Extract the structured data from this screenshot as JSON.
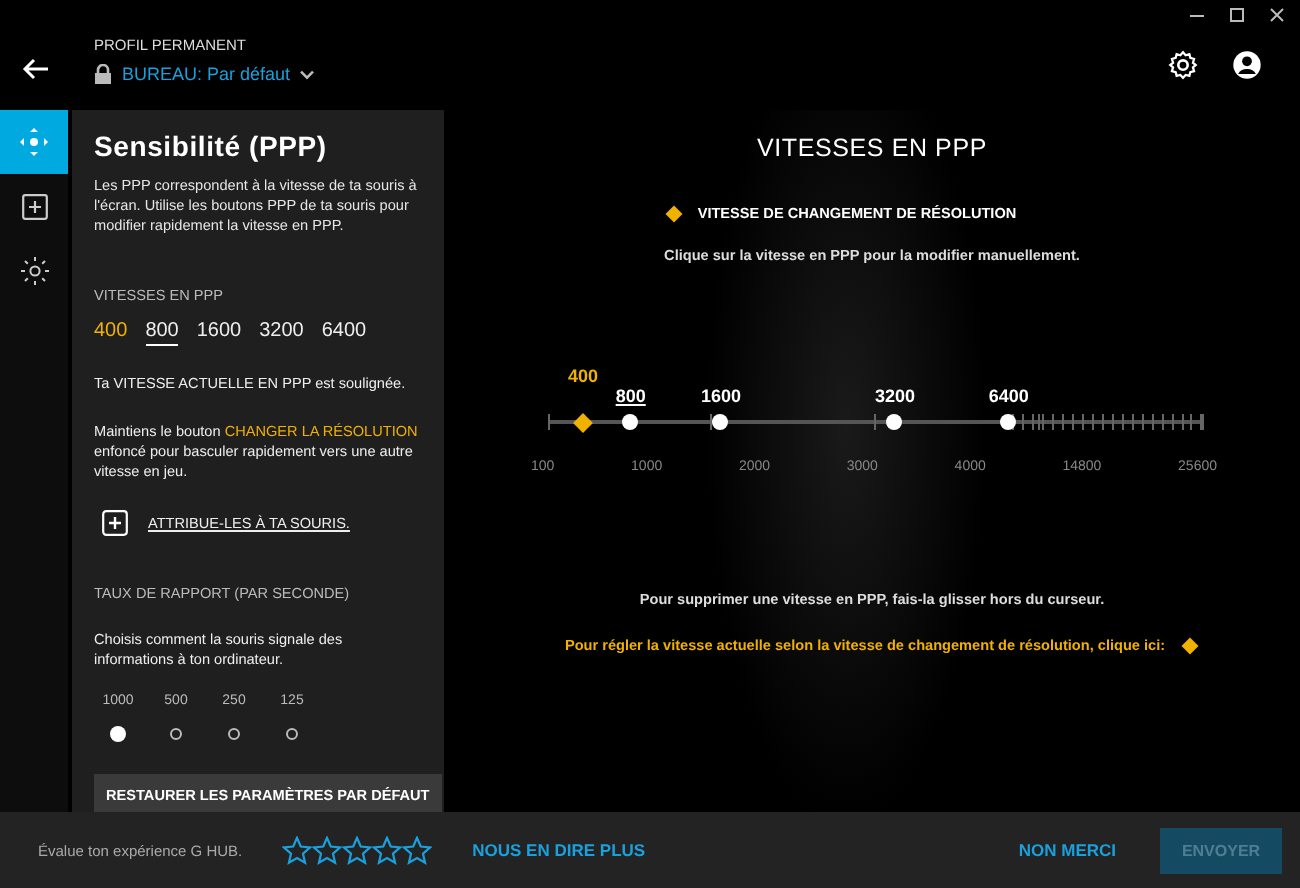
{
  "header": {
    "profile_label": "PROFIL PERMANENT",
    "profile_name": "BUREAU: Par défaut"
  },
  "rail": [
    {
      "kind": "move",
      "selected": true
    },
    {
      "kind": "plus",
      "selected": false
    },
    {
      "kind": "light",
      "selected": false
    }
  ],
  "panel": {
    "title": "Sensibilité (PPP)",
    "description": "Les PPP correspondent à la vitesse de ta souris à l'écran. Utilise les boutons PPP de ta souris pour modifier rapidement la vitesse en PPP.",
    "speeds_heading": "VITESSES EN PPP",
    "speeds": [
      {
        "label": "400",
        "shift": true,
        "current": false
      },
      {
        "label": "800",
        "shift": false,
        "current": true
      },
      {
        "label": "1600",
        "shift": false,
        "current": false
      },
      {
        "label": "3200",
        "shift": false,
        "current": false
      },
      {
        "label": "6400",
        "shift": false,
        "current": false
      }
    ],
    "current_note": "Ta VITESSE ACTUELLE EN PPP est soulignée.",
    "hold_note": {
      "before": "Maintiens le bouton ",
      "highlight": "CHANGER LA RÉSOLUTION",
      "after": " enfoncé pour basculer rapidement vers une autre vitesse en jeu."
    },
    "assign_link": "ATTRIBUE-LES À TA SOURIS.",
    "report_heading": "TAUX DE RAPPORT (PAR SECONDE)",
    "report_description": "Choisis comment la souris signale des informations à ton ordinateur.",
    "rates": [
      {
        "label": "1000",
        "selected": true
      },
      {
        "label": "500",
        "selected": false
      },
      {
        "label": "250",
        "selected": false
      },
      {
        "label": "125",
        "selected": false
      }
    ],
    "restore_button": "RESTAURER LES PARAMÈTRES PAR DÉFAUT"
  },
  "main": {
    "title": "VITESSES EN PPP",
    "legend": "VITESSE DE CHANGEMENT DE RÉSOLUTION",
    "instruction": "Clique sur la vitesse en PPP pour la modifier manuellement.",
    "points": [
      {
        "label": "400",
        "shift": true,
        "current": false,
        "level": 0.055
      },
      {
        "label": "800",
        "shift": false,
        "current": true,
        "level": 0.128
      },
      {
        "label": "1600",
        "shift": false,
        "current": false,
        "level": 0.266
      },
      {
        "label": "3200",
        "shift": false,
        "current": false,
        "level": 0.532
      },
      {
        "label": "6400",
        "shift": false,
        "current": false,
        "level": 0.706
      }
    ],
    "axis_labels": [
      "100",
      "1000",
      "2000",
      "3000",
      "4000",
      "14800",
      "25600"
    ],
    "remove_note": "Pour supprimer une vitesse en PPP, fais-la glisser hors du curseur.",
    "shift_note": "Pour régler la vitesse actuelle selon la vitesse de changement de résolution, clique ici:"
  },
  "footer": {
    "rating_label": "Évalue ton expérience G HUB.",
    "stars": 0,
    "more_link": "NOUS EN DIRE PLUS",
    "no_thanks": "NON MERCI",
    "send_button": {
      "label": "ENVOYER",
      "disabled": true
    }
  }
}
